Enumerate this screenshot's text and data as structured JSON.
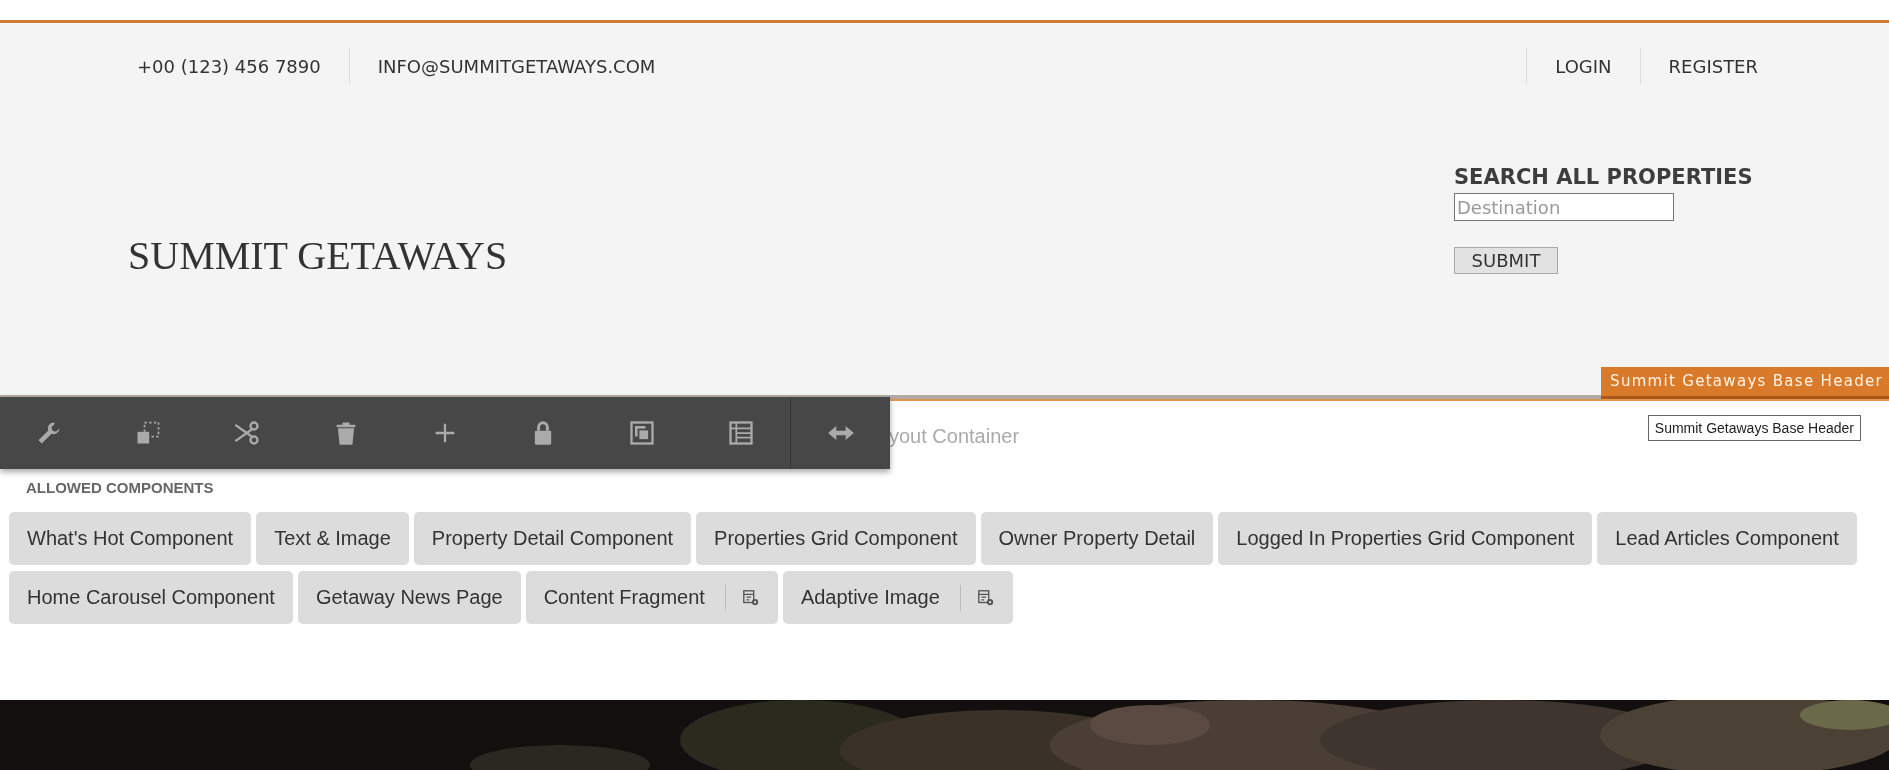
{
  "top_bar": {
    "phone": "+00 (123) 456 7890",
    "email": "INFO@SUMMITGETAWAYS.COM",
    "links": [
      "LOGIN",
      "REGISTER"
    ]
  },
  "logo": "SUMMIT GETAWAYS",
  "search": {
    "title": "SEARCH ALL PROPERTIES",
    "placeholder": "Destination",
    "button": "SUBMIT"
  },
  "component_label": "Summit Getaways Base Header",
  "container_title": "yout Container",
  "tooltip": "Summit Getaways Base Header",
  "allowed_components": {
    "title": "ALLOWED COMPONENTS",
    "items": [
      {
        "label": "What's Hot Component",
        "kind": "plain"
      },
      {
        "label": "Text & Image",
        "kind": "plain"
      },
      {
        "label": "Property Detail Component",
        "kind": "plain"
      },
      {
        "label": "Properties Grid Component",
        "kind": "plain"
      },
      {
        "label": "Owner Property Detail",
        "kind": "plain"
      },
      {
        "label": "Logged In Properties Grid Component",
        "kind": "plain"
      },
      {
        "label": "Lead Articles Component",
        "kind": "plain"
      },
      {
        "label": "Home Carousel Component",
        "kind": "plain"
      },
      {
        "label": "Getaway News Page",
        "kind": "plain"
      },
      {
        "label": "Content Fragment",
        "kind": "configurable"
      },
      {
        "label": "Adaptive Image",
        "kind": "configurable"
      }
    ]
  }
}
